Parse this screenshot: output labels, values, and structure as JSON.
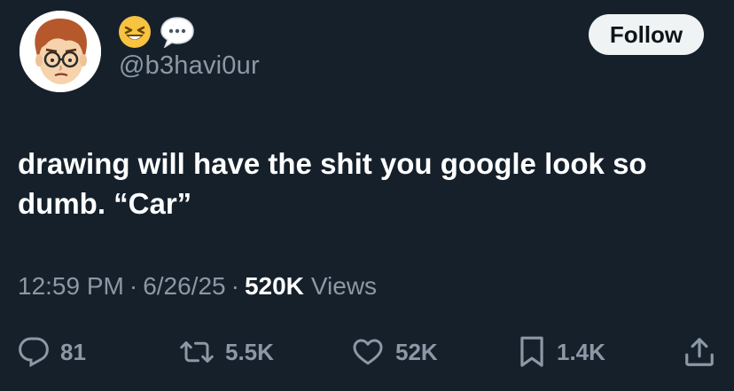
{
  "author": {
    "handle": "@b3havi0ur",
    "avatar_icon": "mii-avatar-with-glasses",
    "name_emojis": [
      "laughing-face-emoji",
      "speech-bubble-emoji"
    ]
  },
  "follow_button": {
    "label": "Follow"
  },
  "tweet": {
    "text": "drawing will have the shit you google look so\ndumb. “Car”"
  },
  "meta": {
    "time": "12:59 PM",
    "separator": "·",
    "date": "6/26/25",
    "views_count": "520K",
    "views_label": "Views"
  },
  "actions": {
    "replies": {
      "icon": "reply-icon",
      "count": "81"
    },
    "reposts": {
      "icon": "repost-icon",
      "count": "5.5K"
    },
    "likes": {
      "icon": "heart-icon",
      "count": "52K"
    },
    "bookmarks": {
      "icon": "bookmark-icon",
      "count": "1.4K"
    },
    "share": {
      "icon": "share-icon"
    }
  },
  "colors": {
    "background": "#15202b",
    "muted_text": "#8b98a5",
    "follow_bg": "#eff3f4"
  }
}
